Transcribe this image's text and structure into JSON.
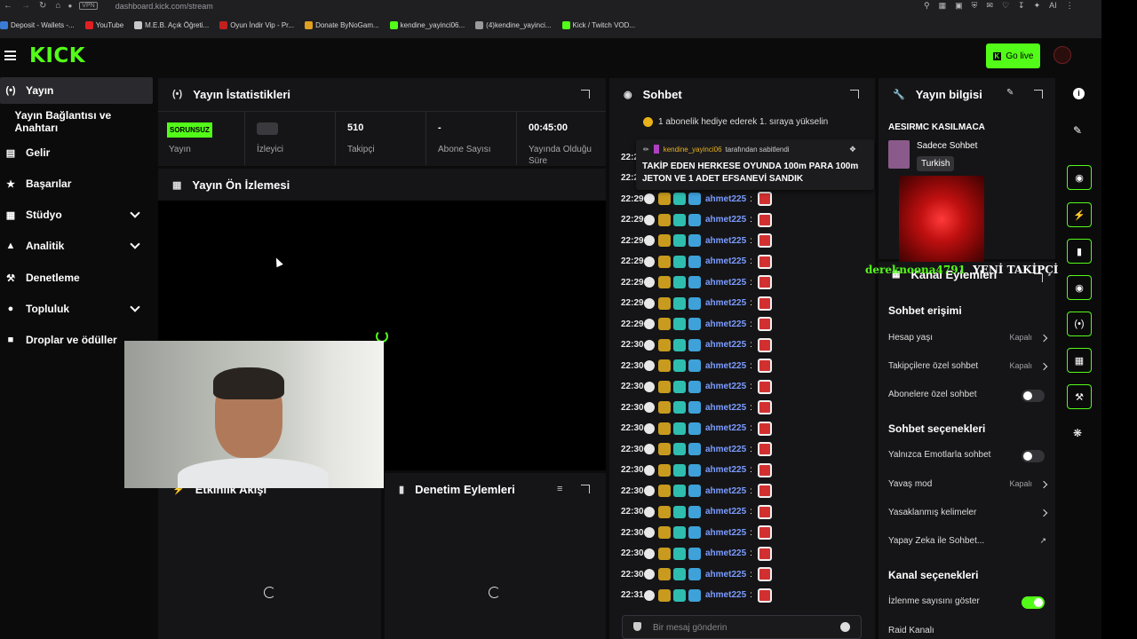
{
  "browser": {
    "url": "dashboard.kick.com/stream",
    "vpn_badge": "VPN",
    "ai_label": "AI",
    "bookmarks": [
      {
        "label": "Deposit - Wallets -...",
        "color": "#3a7bd5"
      },
      {
        "label": "YouTube",
        "color": "#e02020"
      },
      {
        "label": "M.E.B. Açık Öğreti...",
        "color": "#c8c8c8"
      },
      {
        "label": "Oyun İndir Vip - Pr...",
        "color": "#c02020"
      },
      {
        "label": "Donate ByNoGam...",
        "color": "#e0a020"
      },
      {
        "label": "kendine_yayinci06...",
        "color": "#53fc18"
      },
      {
        "label": "(4)kendine_yayinci...",
        "color": "#9a9a9a"
      },
      {
        "label": "Kick / Twitch VOD...",
        "color": "#53fc18"
      }
    ]
  },
  "header": {
    "logo": "KICK",
    "go_live": "Go live"
  },
  "sidebar": {
    "items": [
      {
        "label": "Yayın",
        "icon": "broadcast-icon",
        "active": true
      },
      {
        "label": "Yayın Bağlantısı ve Anahtarı",
        "icon": "",
        "active": false
      },
      {
        "label": "Gelir",
        "icon": "dollar-icon"
      },
      {
        "label": "Başarılar",
        "icon": "trophy-icon"
      },
      {
        "label": "Stüdyo",
        "icon": "studio-icon",
        "expandable": true
      },
      {
        "label": "Analitik",
        "icon": "chart-icon",
        "expandable": true
      },
      {
        "label": "Denetleme",
        "icon": "wrench-icon"
      },
      {
        "label": "Topluluk",
        "icon": "people-icon",
        "expandable": true
      },
      {
        "label": "Droplar ve ödüller",
        "icon": "gift-icon"
      }
    ]
  },
  "stats": {
    "title": "Yayın İstatistikleri",
    "cells": [
      {
        "value": "SORUNSUZ",
        "label": "Yayın"
      },
      {
        "value": "",
        "label": "İzleyici"
      },
      {
        "value": "510",
        "label": "Takipçi"
      },
      {
        "value": "-",
        "label": "Abone Sayısı"
      },
      {
        "value": "00:45:00",
        "label": "Yayında Olduğu Süre"
      }
    ]
  },
  "preview": {
    "title": "Yayın Ön İzlemesi"
  },
  "activity": {
    "title": "Etkinlik Akışı"
  },
  "moderation": {
    "title": "Denetim Eylemleri"
  },
  "chat": {
    "title": "Sohbet",
    "sub_notice": "1 abonelik hediye ederek 1. sıraya yükselin",
    "pinned_by_user": "kendine_yayinci06",
    "pinned_by_suffix": "tarafından sabitlendi",
    "pinned_message": "TAKİP EDEN HERKESE OYUNDA 100m PARA 100m JETON VE 1 ADET EFSANEVİ SANDIK",
    "username": "ahmet225",
    "times": [
      "22:29",
      "22:29",
      "22:29",
      "22:29",
      "22:29",
      "22:29",
      "22:29",
      "22:29",
      "22:29",
      "22:30",
      "22:30",
      "22:30",
      "22:30",
      "22:30",
      "22:30",
      "22:30",
      "22:30",
      "22:30",
      "22:30",
      "22:30",
      "22:30",
      "22:31"
    ],
    "input_placeholder": "Bir mesaj gönderin"
  },
  "info": {
    "title": "Yayın bilgisi",
    "stream_title": "AESIRMC KASILMACA",
    "category": "Sadece Sohbet",
    "language": "Turkish",
    "overlay_user": "dereknoona4791",
    "overlay_text": "YENİ TAKİPÇİ"
  },
  "channel_actions": {
    "title": "Kanal Eylemleri",
    "chat_access": "Sohbet erişimi",
    "account_age": "Hesap yaşı",
    "account_age_value": "Kapalı",
    "followers_only": "Takipçilere özel sohbet",
    "followers_only_value": "Kapalı",
    "subscribers_only": "Abonelere özel sohbet",
    "chat_options": "Sohbet seçenekleri",
    "emote_only": "Yalnızca Emotlarla sohbet",
    "slow_mode": "Yavaş mod",
    "slow_mode_value": "Kapalı",
    "banned_words": "Yasaklanmış kelimeler",
    "ai_chat": "Yapay Zeka ile Sohbet...",
    "channel_options": "Kanal seçenekleri",
    "show_viewers": "İzlenme sayısını göster",
    "raid": "Raid Kanalı"
  },
  "colors": {
    "accent": "#53fc18",
    "panel": "#151517",
    "bg": "#0b0b0c"
  }
}
